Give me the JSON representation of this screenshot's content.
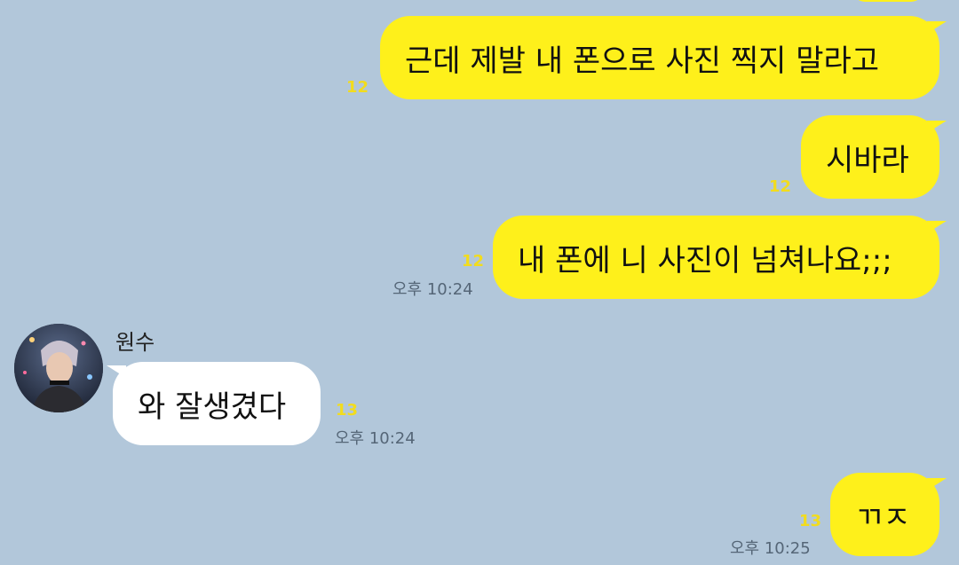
{
  "messages": [
    {
      "text": "근데 제발 내 폰으로 사진 찍지 말라고",
      "unread": "12"
    },
    {
      "text": "시바라",
      "unread": "12"
    },
    {
      "text": "내 폰에 니 사진이 넘쳐나요;;;",
      "unread": "12",
      "time": "오후 10:24"
    },
    {
      "sender": "원수",
      "text": "와 잘생겼다",
      "unread": "13",
      "time": "오후 10:24"
    },
    {
      "text": "ㄲㅈ",
      "unread": "13",
      "time": "오후 10:25"
    }
  ],
  "colors": {
    "background": "#b2c7da",
    "my_bubble": "#fef01b",
    "their_bubble": "#ffffff",
    "unread_count": "#f2dc1d"
  },
  "icons": {
    "avatar": "profile-photo"
  }
}
